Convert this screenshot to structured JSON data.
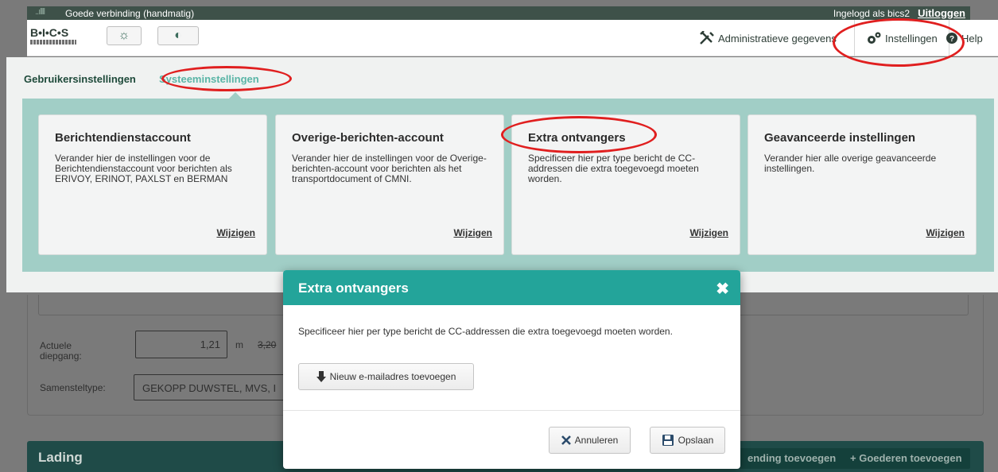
{
  "status_bar": {
    "signal": "..ıllll",
    "connection": "Goede verbinding (handmatig)",
    "logged_in": "Ingelogd als bics2",
    "logout": "Uitloggen"
  },
  "header": {
    "logo": "B•I•C•S",
    "nav_admin": "Administratieve gegevens",
    "nav_settings": "Instellingen",
    "nav_help": "Help"
  },
  "tabs": {
    "user": "Gebruikersinstellingen",
    "system": "Systeeminstellingen"
  },
  "cards": [
    {
      "title": "Berichtendienstaccount",
      "text": "Verander hier de instellingen voor de Berichtendienstaccount voor berichten als ERIVOY, ERINOT, PAXLST en BERMAN",
      "link": "Wijzigen"
    },
    {
      "title": "Overige-berichten-account",
      "text": "Verander hier de instellingen voor de Overige-berichten-account voor berichten als het transportdocument of CMNI.",
      "link": "Wijzigen"
    },
    {
      "title": "Extra ontvangers",
      "text": "Specificeer hier per type bericht de CC-addressen die extra toegevoegd moeten worden.",
      "link": "Wijzigen"
    },
    {
      "title": "Geavanceerde instellingen",
      "text": "Verander hier alle overige geavanceerde instellingen.",
      "link": "Wijzigen"
    }
  ],
  "form": {
    "actual_draft_label": "Actuele diepgang:",
    "actual_draft_value": "1,21",
    "draft_unit": "m",
    "draft_extra": "3,20",
    "composition_label": "Samensteltype:",
    "composition_value": "GEKOPP DUWSTEL, MVS, I"
  },
  "lading": {
    "title": "Lading",
    "btn_shipment": "ending toevoegen",
    "btn_goods": "+ Goederen toevoegen"
  },
  "modal": {
    "title": "Extra ontvangers",
    "close": "✖",
    "description": "Specificeer hier per type bericht de CC-addressen die extra toegevoegd moeten worden.",
    "add_email": "Nieuw e-mailadres toevoegen",
    "cancel": "Annuleren",
    "save": "Opslaan"
  },
  "colors": {
    "accent": "#23a49a",
    "dark_green": "#3e5149",
    "annotation": "#e01f1f"
  }
}
